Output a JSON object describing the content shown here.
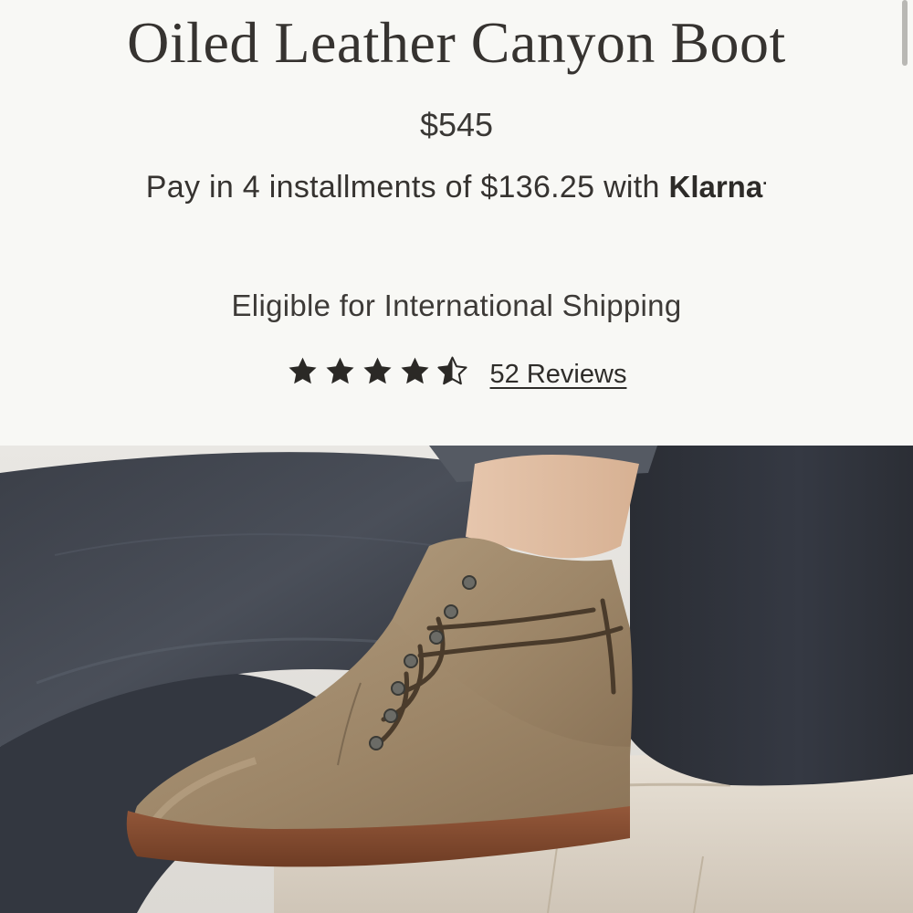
{
  "product": {
    "title": "Oiled Leather Canyon Boot",
    "price": "$545",
    "installments_text": "Pay in 4 installments of $136.25 with",
    "payment_provider": "Klarna",
    "payment_provider_dot": ".",
    "shipping_note": "Eligible for International Shipping",
    "rating": 4.5,
    "rating_max": 5,
    "reviews_label": "52 Reviews"
  },
  "icons": {
    "star_full": "star-icon",
    "star_half": "half-star-icon"
  },
  "colors": {
    "background": "#f8f8f5",
    "text": "#363330",
    "boot_leather": "#a08a6d",
    "sole": "#8a4e30",
    "denim": "#3a3d45"
  }
}
